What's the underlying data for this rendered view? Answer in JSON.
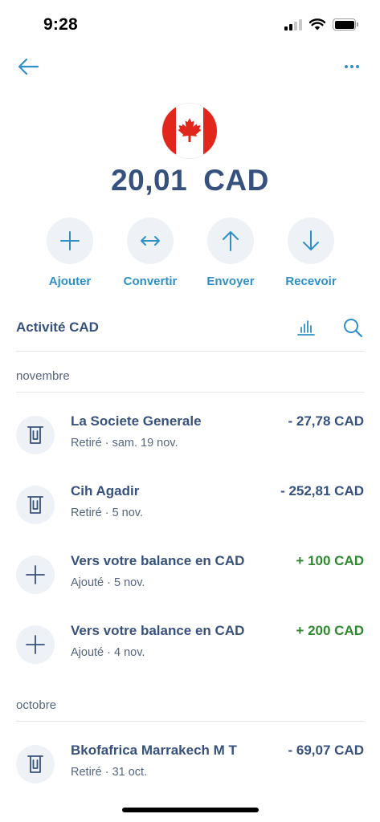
{
  "status_bar": {
    "time": "9:28"
  },
  "header": {
    "balance_amount": "20,01",
    "balance_currency": "CAD"
  },
  "actions": [
    {
      "label": "Ajouter",
      "icon": "plus-icon"
    },
    {
      "label": "Convertir",
      "icon": "convert-arrows-icon"
    },
    {
      "label": "Envoyer",
      "icon": "arrow-up-icon"
    },
    {
      "label": "Recevoir",
      "icon": "arrow-down-icon"
    }
  ],
  "activity": {
    "title": "Activité CAD",
    "months": [
      {
        "label": "novembre"
      },
      {
        "label": "octobre"
      }
    ],
    "transactions": [
      {
        "title": "La Societe Generale",
        "subtitle": "Retiré · sam. 19 nov.",
        "amount": "- 27,78 CAD",
        "type": "withdrawal",
        "icon": "atm-withdrawal-icon"
      },
      {
        "title": "Cih Agadir",
        "subtitle": "Retiré · 5 nov.",
        "amount": "- 252,81 CAD",
        "type": "withdrawal",
        "icon": "atm-withdrawal-icon"
      },
      {
        "title": "Vers votre balance en CAD",
        "subtitle": "Ajouté · 5 nov.",
        "amount": "+ 100 CAD",
        "type": "deposit",
        "icon": "plus-icon"
      },
      {
        "title": "Vers votre balance en CAD",
        "subtitle": "Ajouté · 4 nov.",
        "amount": "+ 200 CAD",
        "type": "deposit",
        "icon": "plus-icon"
      },
      {
        "title": "Bkofafrica Marrakech M T",
        "subtitle": "Retiré · 31 oct.",
        "amount": "- 69,07 CAD",
        "type": "withdrawal",
        "icon": "atm-withdrawal-icon"
      }
    ]
  },
  "colors": {
    "accent": "#2e90c8",
    "text": "#37517e",
    "positive": "#2e8a2e",
    "flag_red": "#e1261c"
  }
}
